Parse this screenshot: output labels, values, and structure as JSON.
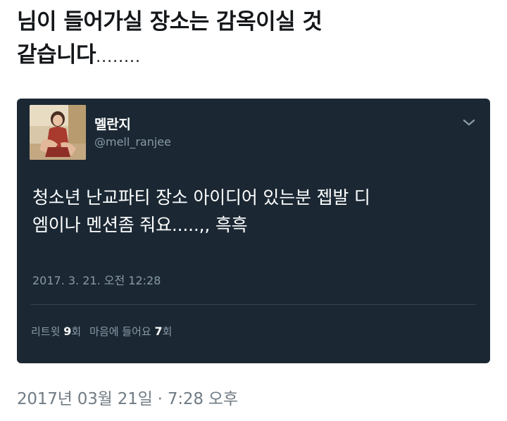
{
  "post": {
    "text_line1": "님이 들어가실 장소는 감옥이실 것",
    "text_line2": "같습니다",
    "text_dots": "........",
    "date": "2017년 03월 21일 · 7:28 오후"
  },
  "tweet": {
    "display_name": "멜란지",
    "handle": "@mell_ranjee",
    "text_line1": "청소년 난교파티 장소 아이디어 있는분 젭발 디",
    "text_line2": "엠이나 멘션좀 줘요.....,, 흑흑",
    "timestamp": "2017. 3. 21. 오전 12:28",
    "retweet_label": "리트윗",
    "retweet_count": "9",
    "retweet_unit": "회",
    "like_label": "마음에 들어요",
    "like_count": "7",
    "like_unit": "회",
    "menu_icon": "chevron-down-icon",
    "background_color": "#1b2834"
  }
}
